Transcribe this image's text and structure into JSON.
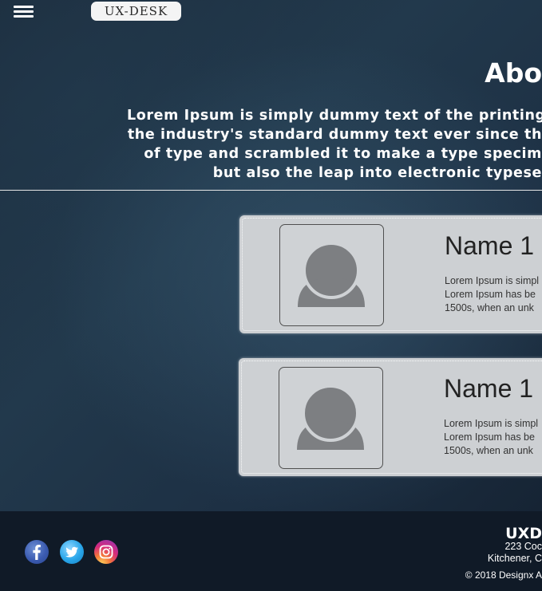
{
  "header": {
    "logo_text": "UX-DESK",
    "menu_icon": "hamburger-menu-icon"
  },
  "about": {
    "title": "Abo",
    "lines": [
      "Lorem Ipsum is simply dummy text of the printing",
      "the industry's standard dummy text ever since th",
      "of type and scrambled it to make a type specim",
      "but also the leap into electronic typese"
    ]
  },
  "team": [
    {
      "name": "Name 1",
      "avatar_icon": "person-placeholder-icon",
      "desc": [
        "Lorem Ipsum is simpl",
        "Lorem Ipsum has be",
        "1500s, when an unk"
      ]
    },
    {
      "name": "Name 1",
      "avatar_icon": "person-placeholder-icon",
      "desc": [
        "Lorem Ipsum is simpl",
        "Lorem Ipsum has be",
        "1500s, when an unk"
      ]
    }
  ],
  "footer": {
    "social": [
      {
        "name": "facebook",
        "icon": "facebook-icon",
        "color": "#3b5bb0"
      },
      {
        "name": "twitter",
        "icon": "twitter-icon",
        "color": "#29a6ea"
      },
      {
        "name": "instagram",
        "icon": "instagram-icon",
        "color": "#d62a7c"
      }
    ],
    "brand": "UXD",
    "address_line1": "223 Coc",
    "address_line2": "Kitchener, C",
    "copyright": "© 2018 Designx A"
  },
  "colors": {
    "background": "#1d3044",
    "footer_background": "#101a27",
    "card_background": "#cdd0d3",
    "text_light": "#ffffff"
  }
}
